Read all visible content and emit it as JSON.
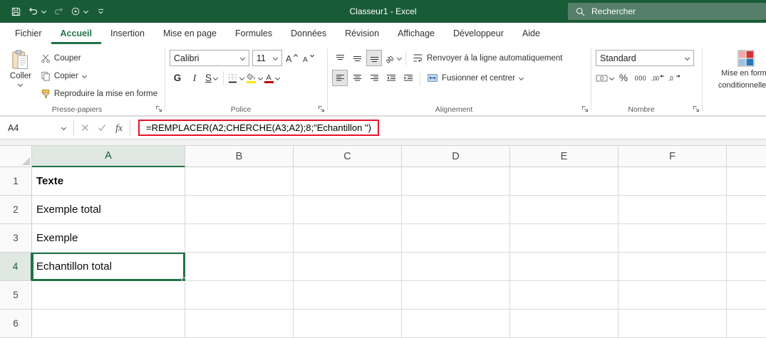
{
  "colors": {
    "titlebar_green": "#185C37",
    "accent_green": "#217346",
    "annotation_red": "#E8112D",
    "fill_yellow": "#FFE400",
    "font_color_red": "#C00000"
  },
  "titlebar": {
    "title": "Classeur1 -  Excel",
    "search_label": "Rechercher"
  },
  "tabs": [
    "Fichier",
    "Accueil",
    "Insertion",
    "Mise en page",
    "Formules",
    "Données",
    "Révision",
    "Affichage",
    "Développeur",
    "Aide"
  ],
  "ribbon": {
    "clipboard": {
      "group_label": "Presse-papiers",
      "paste": "Coller",
      "cut": "Couper",
      "copy": "Copier",
      "format_painter": "Reproduire la mise en forme"
    },
    "font": {
      "group_label": "Police",
      "font_name": "Calibri",
      "font_size": "11",
      "bold": "G",
      "italic": "I",
      "underline": "S"
    },
    "alignment": {
      "group_label": "Alignement",
      "wrap_text": "Renvoyer à la ligne automatiquement",
      "merge_center": "Fusionner et centrer"
    },
    "number": {
      "group_label": "Nombre",
      "format": "Standard",
      "percent": "%",
      "thousands": "000"
    },
    "styles": {
      "conditional_formatting_line1": "Mise en forme",
      "conditional_formatting_line2": "conditionnelle"
    }
  },
  "formula_bar": {
    "name_box": "A4",
    "fx": "fx",
    "formula": "=REMPLACER(A2;CHERCHE(A3;A2);8;\"Echantillon \")"
  },
  "grid": {
    "columns": [
      "A",
      "B",
      "C",
      "D",
      "E",
      "F"
    ],
    "rows": [
      "1",
      "2",
      "3",
      "4",
      "5",
      "6"
    ],
    "active_cell": "A4",
    "cells": {
      "A1": "Texte",
      "A2": "Exemple total",
      "A3": "Exemple",
      "A4": "Echantillon total"
    }
  }
}
